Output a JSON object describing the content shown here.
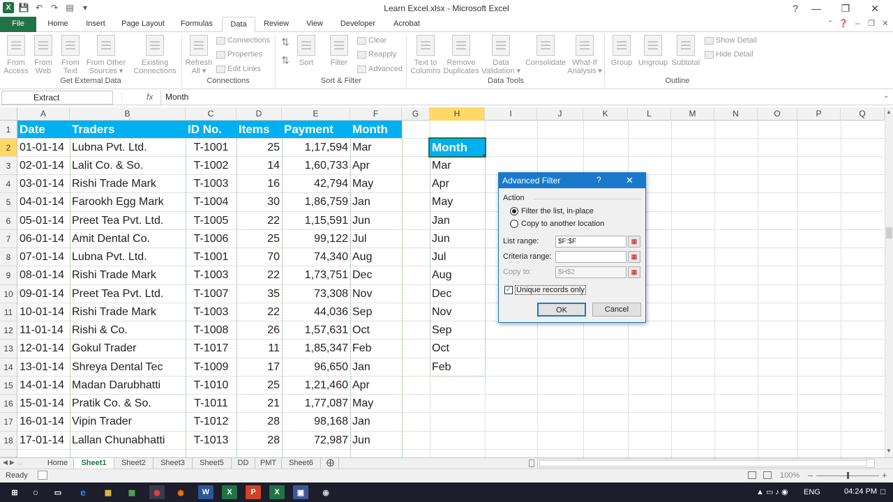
{
  "window": {
    "title": "Learn Excel.xlsx - Microsoft Excel"
  },
  "qat": {
    "excel_icon": "excel-icon",
    "save_icon": "save-icon",
    "undo_icon": "undo-icon",
    "redo_icon": "redo-icon"
  },
  "tabs": [
    "File",
    "Home",
    "Insert",
    "Page Layout",
    "Formulas",
    "Data",
    "Review",
    "View",
    "Developer",
    "Acrobat"
  ],
  "ribbon": {
    "ext_data": {
      "from_access": "From\nAccess",
      "from_web": "From\nWeb",
      "from_text": "From\nText",
      "from_other": "From Other\nSources ▾",
      "existing": "Existing\nConnections",
      "label": "Get External Data"
    },
    "connections": {
      "refresh": "Refresh\nAll ▾",
      "connections": "Connections",
      "properties": "Properties",
      "edit_links": "Edit Links",
      "label": "Connections"
    },
    "sortfilter": {
      "sort": "Sort",
      "filter": "Filter",
      "clear": "Clear",
      "reapply": "Reapply",
      "advanced": "Advanced",
      "label": "Sort & Filter"
    },
    "datatools": {
      "text_to_columns": "Text to\nColumns",
      "remove_dup": "Remove\nDuplicates",
      "data_validation": "Data\nValidation ▾",
      "consolidate": "Consolidate",
      "whatif": "What-If\nAnalysis ▾",
      "label": "Data Tools"
    },
    "outline": {
      "group": "Group",
      "ungroup": "Ungroup",
      "subtotal": "Subtotal",
      "show_detail": "Show Detail",
      "hide_detail": "Hide Detail",
      "label": "Outline"
    }
  },
  "formula_bar": {
    "name_box": "Extract",
    "fx": "fx",
    "formula": "Month"
  },
  "columns": [
    "A",
    "B",
    "C",
    "D",
    "E",
    "F",
    "G",
    "H",
    "I",
    "J",
    "K",
    "L",
    "M",
    "N",
    "O",
    "P",
    "Q"
  ],
  "rows": [
    "1",
    "2",
    "3",
    "4",
    "5",
    "6",
    "7",
    "8",
    "9",
    "10",
    "11",
    "12",
    "13",
    "14",
    "15",
    "16",
    "17",
    "18"
  ],
  "table": {
    "headers": [
      "Date",
      "Traders",
      "ID No.",
      "Items",
      "Payment",
      "Month"
    ],
    "rows": [
      [
        "01-01-14",
        "Lubna Pvt. Ltd.",
        "T-1001",
        "25",
        "1,17,594",
        "Mar"
      ],
      [
        "02-01-14",
        "Lalit Co. & So.",
        "T-1002",
        "14",
        "1,60,733",
        "Apr"
      ],
      [
        "03-01-14",
        "Rishi Trade Mark",
        "T-1003",
        "16",
        "42,794",
        "May"
      ],
      [
        "04-01-14",
        "Farookh Egg Mark",
        "T-1004",
        "30",
        "1,86,759",
        "Jan"
      ],
      [
        "05-01-14",
        "Preet Tea Pvt. Ltd.",
        "T-1005",
        "22",
        "1,15,591",
        "Jun"
      ],
      [
        "06-01-14",
        "Amit Dental Co.",
        "T-1006",
        "25",
        "99,122",
        "Jul"
      ],
      [
        "07-01-14",
        "Lubna Pvt. Ltd.",
        "T-1001",
        "70",
        "74,340",
        "Aug"
      ],
      [
        "08-01-14",
        "Rishi Trade Mark",
        "T-1003",
        "22",
        "1,73,751",
        "Dec"
      ],
      [
        "09-01-14",
        "Preet Tea Pvt. Ltd.",
        "T-1007",
        "35",
        "73,308",
        "Nov"
      ],
      [
        "10-01-14",
        "Rishi Trade Mark",
        "T-1003",
        "22",
        "44,036",
        "Sep"
      ],
      [
        "11-01-14",
        "Rishi & Co.",
        "T-1008",
        "26",
        "1,57,631",
        "Oct"
      ],
      [
        "12-01-14",
        "Gokul Trader",
        "T-1017",
        "11",
        "1,85,347",
        "Feb"
      ],
      [
        "13-01-14",
        "Shreya Dental Tec",
        "T-1009",
        "17",
        "96,650",
        "Jan"
      ],
      [
        "14-01-14",
        "Madan Darubhatti",
        "T-1010",
        "25",
        "1,21,460",
        "Apr"
      ],
      [
        "15-01-14",
        "Pratik Co. & So.",
        "T-1011",
        "21",
        "1,77,087",
        "May"
      ],
      [
        "16-01-14",
        "Vipin Trader",
        "T-1012",
        "28",
        "98,168",
        "Jan"
      ],
      [
        "17-01-14",
        "Lallan Chunabhatti",
        "T-1013",
        "28",
        "72,987",
        "Jun"
      ]
    ]
  },
  "criteria": {
    "header": "Month",
    "values": [
      "Mar",
      "Apr",
      "May",
      "Jan",
      "Jun",
      "Jul",
      "Aug",
      "Dec",
      "Nov",
      "Sep",
      "Oct",
      "Feb"
    ]
  },
  "dialog": {
    "title": "Advanced Filter",
    "help": "?",
    "close": "✕",
    "action_label": "Action",
    "option1": "Filter the list, in-place",
    "option2": "Copy to another location",
    "list_range_label": "List range:",
    "list_range_value": "$F:$F",
    "criteria_label": "Criteria range:",
    "criteria_value": "",
    "copy_to_label": "Copy to:",
    "copy_to_value": "$H$2",
    "unique_label": "Unique records only",
    "ok": "OK",
    "cancel": "Cancel"
  },
  "sheets": [
    "Home",
    "Sheet1",
    "Sheet2",
    "Sheet3",
    "Sheet5",
    "DD",
    "PMT",
    "Sheet6"
  ],
  "status": {
    "ready": "Ready",
    "zoom": "100%"
  },
  "taskbar": {
    "lang": "ENG",
    "time": "04:24 PM"
  },
  "colors": {
    "excel_green": "#217346",
    "header_fill": "#00b0f0",
    "dialog_title": "#1979ca"
  }
}
